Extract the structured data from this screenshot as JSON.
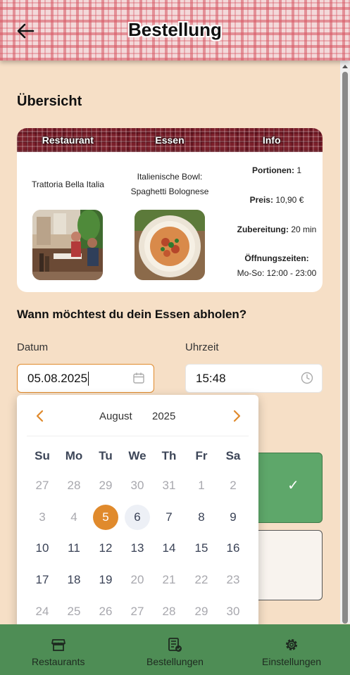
{
  "header": {
    "title": "Bestellung",
    "back_icon": "arrow-left-icon"
  },
  "overview": {
    "title": "Übersicht",
    "columns": [
      "Restaurant",
      "Essen",
      "Info"
    ],
    "restaurant_name": "Trattoria Bella Italia",
    "dish_line1": "Italienische Bowl:",
    "dish_line2": "Spaghetti Bolognese",
    "portions_label": "Portionen:",
    "portions_value": "1",
    "price_label": "Preis:",
    "price_value": "10,90 €",
    "prep_label": "Zubereitung:",
    "prep_value": "20 min",
    "hours_label": "Öffnungszeiten:",
    "hours_value": "Mo-So: 12:00 - 23:00"
  },
  "pickup": {
    "question": "Wann möchtest du dein Essen abholen?",
    "date_label": "Datum",
    "date_value": "05.08.2025",
    "time_label": "Uhrzeit",
    "time_value": "15:48"
  },
  "calendar": {
    "month": "August",
    "year": "2025",
    "weekdays": [
      "Su",
      "Mo",
      "Tu",
      "We",
      "Th",
      "Fr",
      "Sa"
    ],
    "weeks": [
      [
        "27",
        "28",
        "29",
        "30",
        "31",
        "1",
        "2"
      ],
      [
        "3",
        "4",
        "5",
        "6",
        "7",
        "8",
        "9"
      ],
      [
        "10",
        "11",
        "12",
        "13",
        "14",
        "15",
        "16"
      ],
      [
        "17",
        "18",
        "19",
        "20",
        "21",
        "22",
        "23"
      ],
      [
        "24",
        "25",
        "26",
        "27",
        "28",
        "29",
        "30"
      ]
    ],
    "selected_day": "5",
    "today_day": "6"
  },
  "nav": {
    "restaurants": "Restaurants",
    "orders": "Bestellungen",
    "settings": "Einstellungen"
  },
  "colors": {
    "accent": "#e08a2c",
    "nav_green": "#4e8d55",
    "confirm_green": "#5ea76a",
    "background": "#f6dfc6"
  }
}
